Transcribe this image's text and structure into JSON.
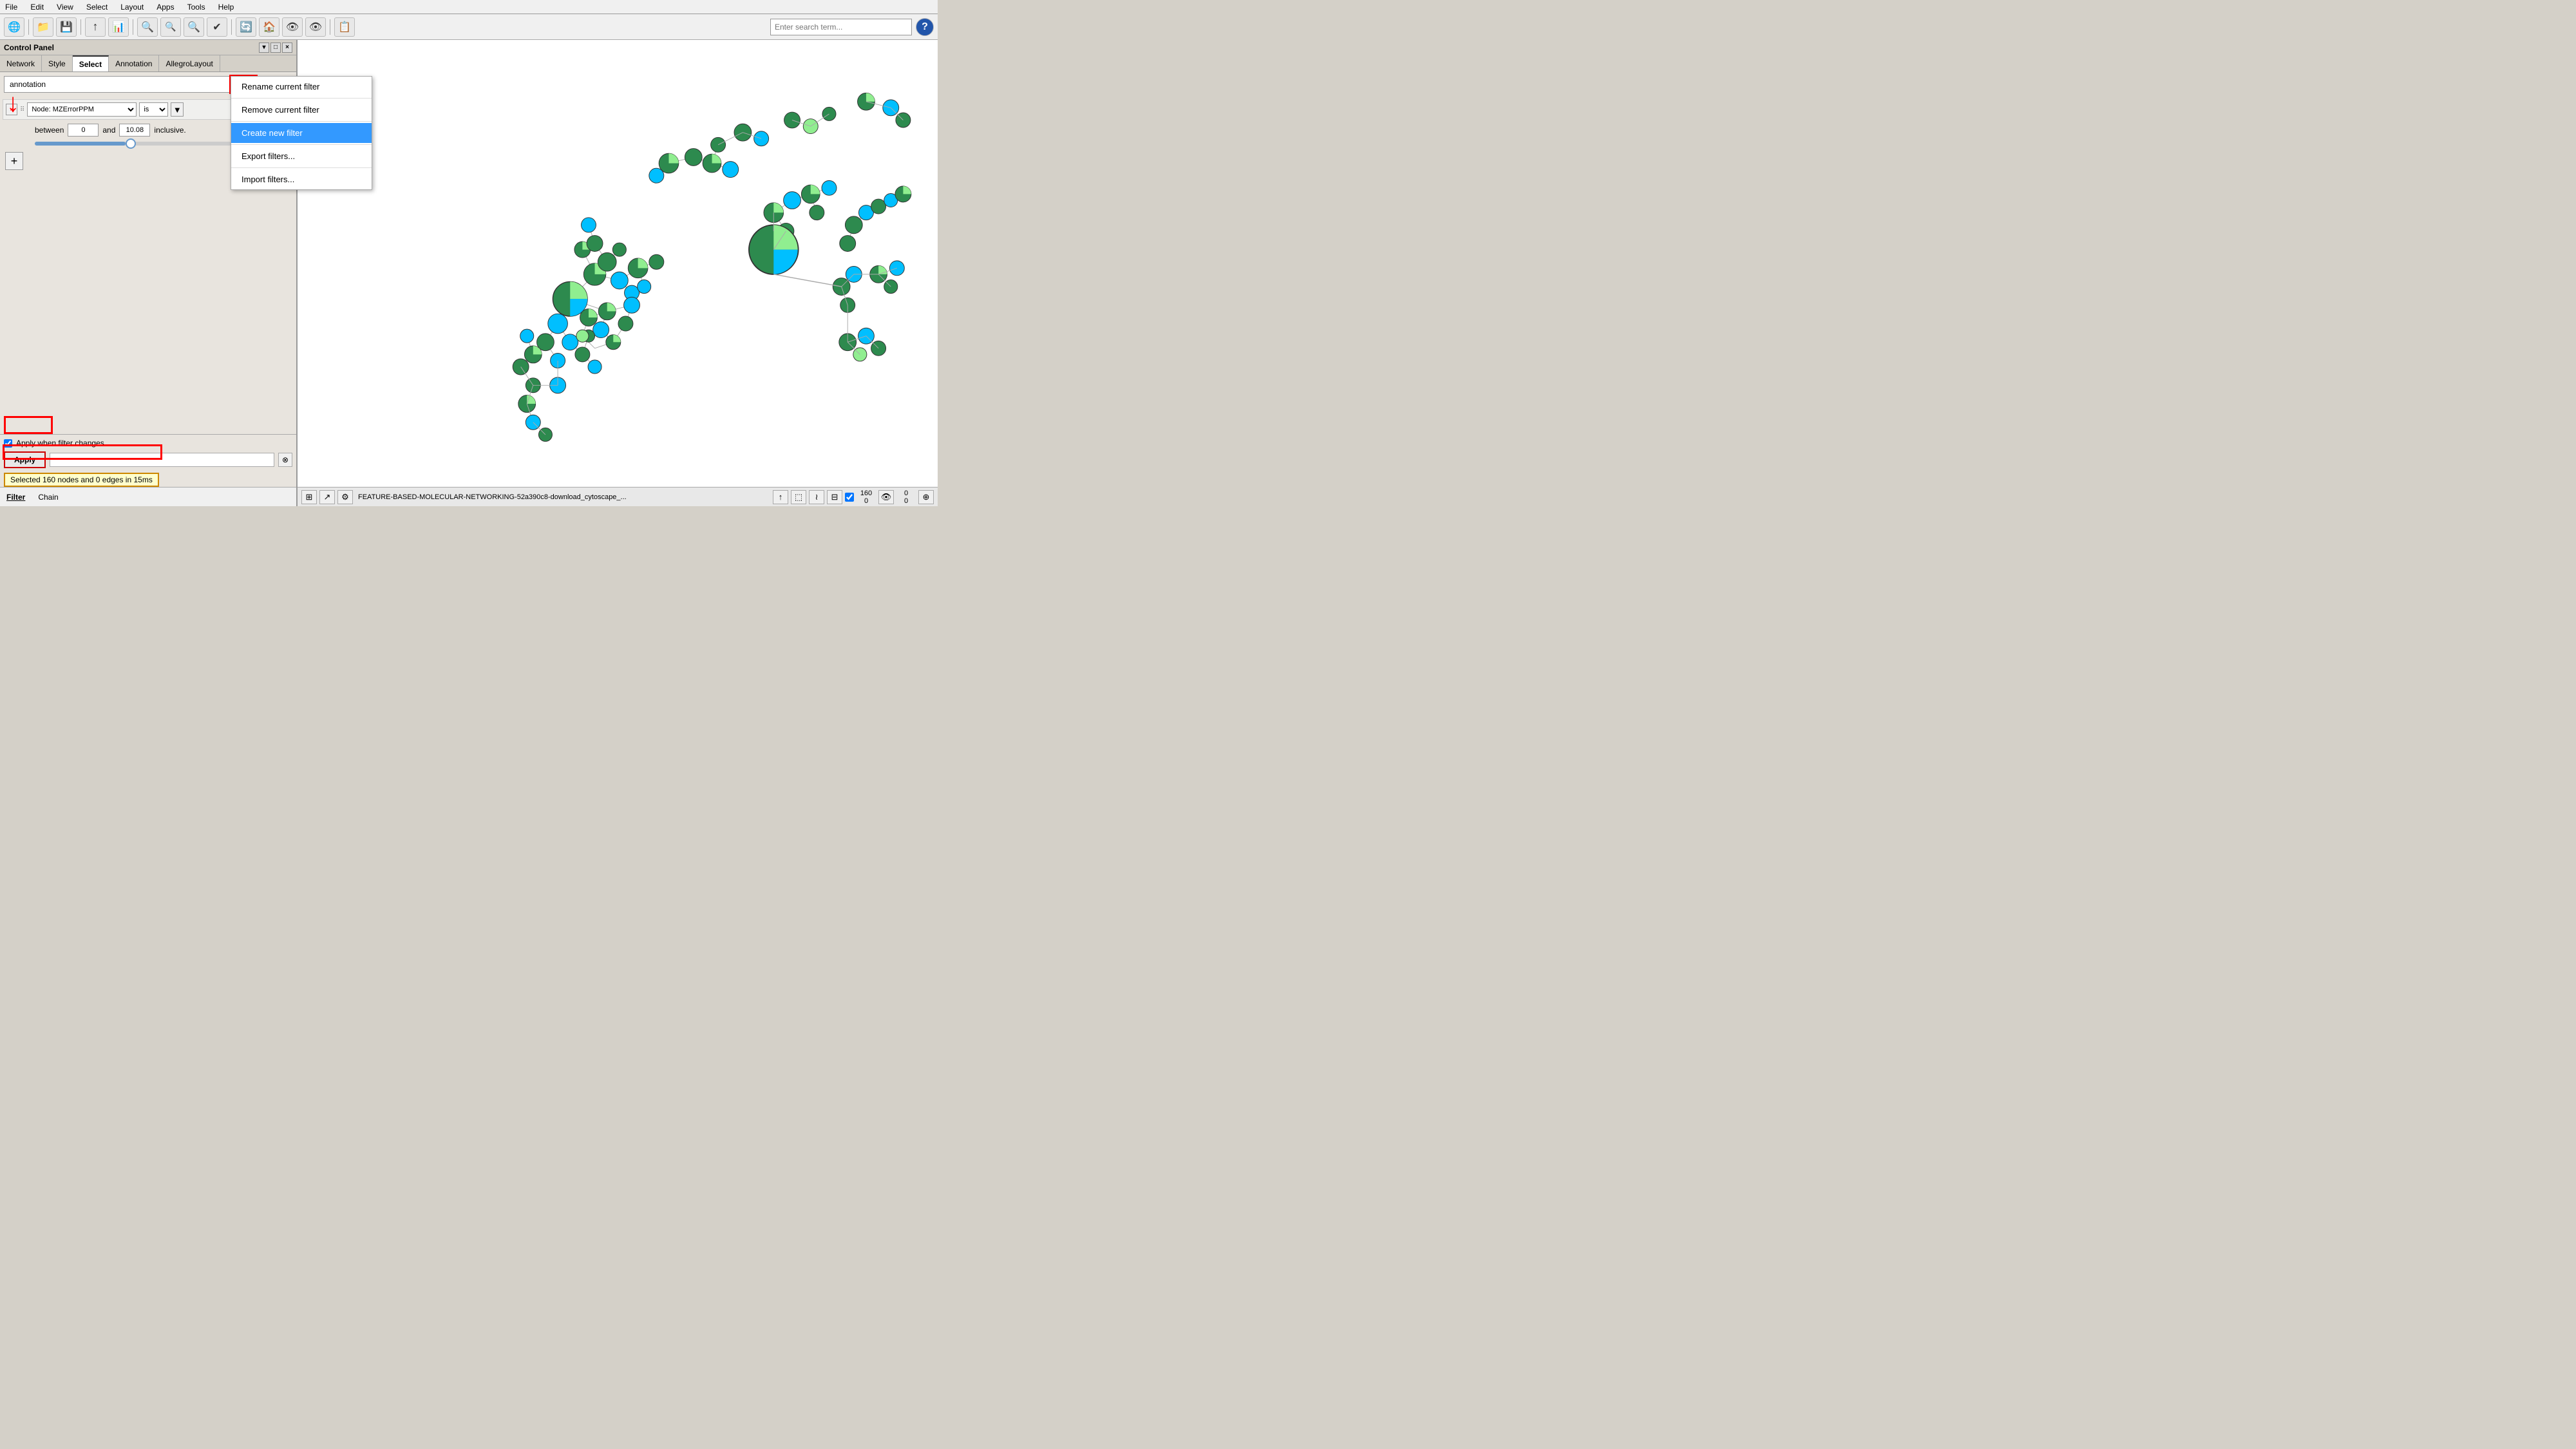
{
  "menubar": {
    "items": [
      "File",
      "Edit",
      "View",
      "Select",
      "Layout",
      "Apps",
      "Tools",
      "Help"
    ]
  },
  "toolbar": {
    "search_placeholder": "Enter search term...",
    "buttons": [
      "🌐",
      "📁",
      "💾",
      "📤",
      "📊",
      "🔍+",
      "🔍-",
      "🔍",
      "✔",
      "🔄",
      "🏠",
      "👁",
      "👁",
      "📋"
    ]
  },
  "panel": {
    "title": "Control Panel",
    "tabs": [
      "Network",
      "Style",
      "Select",
      "Annotation",
      "AllegroLayout"
    ]
  },
  "filter": {
    "current_filter": "annotation",
    "menu_items": [
      {
        "label": "Rename current filter",
        "highlighted": false
      },
      {
        "label": "Remove current filter",
        "highlighted": false
      },
      {
        "label": "Create new filter",
        "highlighted": true
      },
      {
        "label": "Export filters...",
        "highlighted": false
      },
      {
        "label": "Import filters...",
        "highlighted": false
      }
    ],
    "condition": {
      "node_attribute": "Node: MZErrorPPM",
      "operator": "is",
      "range_min": 0,
      "range_max": 10.08,
      "range_label": "between",
      "range_connector": "and",
      "inclusive_label": "inclusive."
    },
    "apply_when_label": "Apply when filter changes",
    "apply_btn": "Apply",
    "status": "Selected 160 nodes and 0 edges in 15ms"
  },
  "bottom_tabs": {
    "filter_label": "Filter",
    "chain_label": "Chain"
  },
  "network_bar": {
    "name": "FEATURE-BASED-MOLECULAR-NETWORKING-52a390c8-download_cytoscape_...",
    "node_count": "160",
    "edge_count": "0",
    "node_label": "",
    "edge_label": ""
  },
  "icons": {
    "menu": "≡",
    "close": "×",
    "plus": "+",
    "check": "✓",
    "cancel": "⊗",
    "grid": "⊞",
    "share": "↗",
    "settings": "⚙",
    "export": "↑",
    "back": "↩",
    "forward": "↪",
    "select_box": "⬚",
    "select_lasso": "≀",
    "select_table": "⊟",
    "compass": "⊕"
  }
}
